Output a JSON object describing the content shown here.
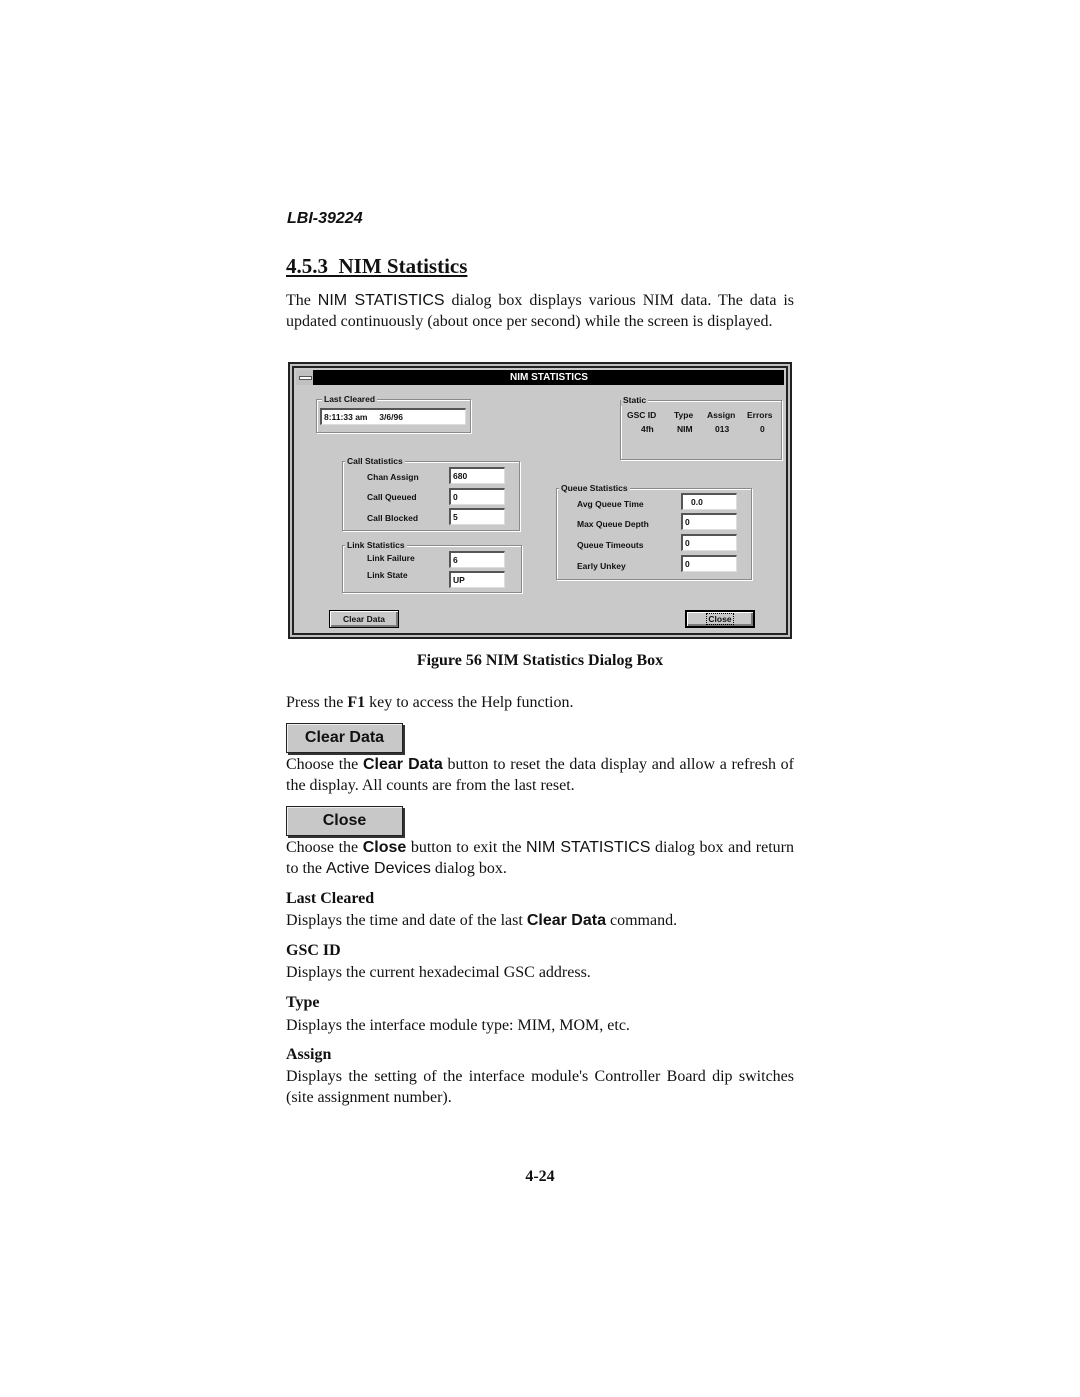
{
  "header": {
    "doc_id": "LBI-39224"
  },
  "section": {
    "number": "4.5.3",
    "title": "NIM Statistics",
    "intro": {
      "p1": "The ",
      "p1_sans": "NIM STATISTICS",
      "p1_rest": " dialog box displays various NIM data.  The data is updated continuously (about once per second) while the screen is displayed."
    }
  },
  "dialog": {
    "title": "NIM STATISTICS",
    "sysmenu_icon": "system-menu-icon",
    "last_cleared": {
      "label": "Last Cleared",
      "time": "8:11:33 am",
      "date": "3/6/96"
    },
    "static": {
      "label": "Static",
      "columns": [
        "GSC ID",
        "Type",
        "Assign",
        "Errors"
      ],
      "values": [
        "4fh",
        "NIM",
        "013",
        "0"
      ]
    },
    "call_statistics": {
      "label": "Call Statistics",
      "rows": [
        {
          "label": "Chan Assign",
          "value": "680"
        },
        {
          "label": "Call Queued",
          "value": "0"
        },
        {
          "label": "Call Blocked",
          "value": "5"
        }
      ]
    },
    "link_statistics": {
      "label": "Link Statistics",
      "rows": [
        {
          "label": "Link Failure",
          "value": "6"
        },
        {
          "label": "Link State",
          "value": "UP"
        }
      ]
    },
    "queue_statistics": {
      "label": "Queue Statistics",
      "rows": [
        {
          "label": "Avg Queue Time",
          "value": "0.0"
        },
        {
          "label": "Max Queue Depth",
          "value": "0"
        },
        {
          "label": "Queue Timeouts",
          "value": "0"
        },
        {
          "label": "Early Unkey",
          "value": "0"
        }
      ]
    },
    "buttons": {
      "clear_data": "Clear Data",
      "close": "Close"
    }
  },
  "figure": {
    "caption": "Figure 56  NIM Statistics Dialog Box"
  },
  "help": {
    "pre": "Press the ",
    "key": "F1",
    "post": " key to access the Help function."
  },
  "clear_data": {
    "button": "Clear Data",
    "p_pre": "Choose the ",
    "p_btn": "Clear Data",
    "p_post": " button to reset the data display and allow a refresh of the display.  All counts are from the last reset."
  },
  "close": {
    "button": "Close",
    "p_pre": "Choose the ",
    "p_btn": "Close",
    "p_mid": " button to exit the ",
    "p_dlg": "NIM STATISTICS",
    "p_mid2": " dialog box and return to the ",
    "p_dlg2": "Active Devices",
    "p_post": " dialog box."
  },
  "terms": [
    {
      "term": "Last Cleared",
      "pre": "Displays the time and date of the last ",
      "bold": "Clear Data",
      "post": " command."
    },
    {
      "term": "GSC ID",
      "desc": "Displays the current hexadecimal GSC address."
    },
    {
      "term": "Type",
      "desc": "Displays the interface module type: MIM, MOM, etc."
    },
    {
      "term": "Assign",
      "desc": "Displays the setting of the interface module's Controller Board dip switches (site assignment number)."
    }
  ],
  "footer": {
    "page": "4-24"
  }
}
